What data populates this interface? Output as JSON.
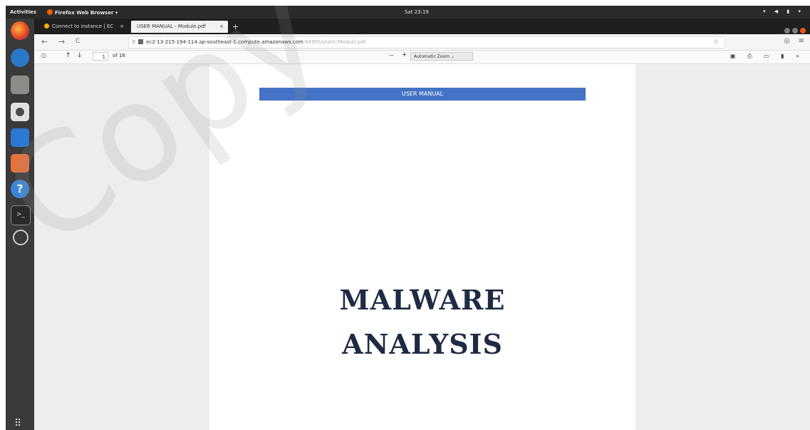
{
  "topbar": {
    "activities": "Activities",
    "app_name": "Firefox Web Browser ▾",
    "clock": "Sat 23:19",
    "tray": "▾ ◀ ▮ ▾"
  },
  "dock": {
    "items": [
      "firefox-icon",
      "thunderbird-icon",
      "files-icon",
      "rhythmbox-icon",
      "writer-icon",
      "software-icon",
      "help-icon",
      "terminal-icon",
      "updater-icon"
    ],
    "apps_grid": "⠿"
  },
  "tabs": [
    {
      "label": "Connect to instance | EC",
      "close": "×"
    },
    {
      "label": "USER MANUAL - Module.pdf",
      "close": "×"
    }
  ],
  "new_tab": "+",
  "nav": {
    "back": "←",
    "forward": "→",
    "reload": "C",
    "url_host": "ec2-13-215-194-114.ap-southeast-1.compute.amazonaws.com",
    "url_path": ":64995/static/Module.pdf",
    "star": "☆",
    "shield": "◎",
    "menu": "≡"
  },
  "pdf_toolbar": {
    "sidebar_toggle": "◫",
    "prev": "↑",
    "next": "↓",
    "page_number": "1",
    "page_count": "of 16",
    "zoom_out": "—",
    "zoom_in": "+",
    "zoom_value": "Automatic Zoom ⌄",
    "tools": "▣ ⎙ ▭ ▮ »"
  },
  "document": {
    "banner": "USER MANUAL",
    "title_line1": "MALWARE",
    "title_line2": "ANALYSIS"
  },
  "watermark": "Copy"
}
